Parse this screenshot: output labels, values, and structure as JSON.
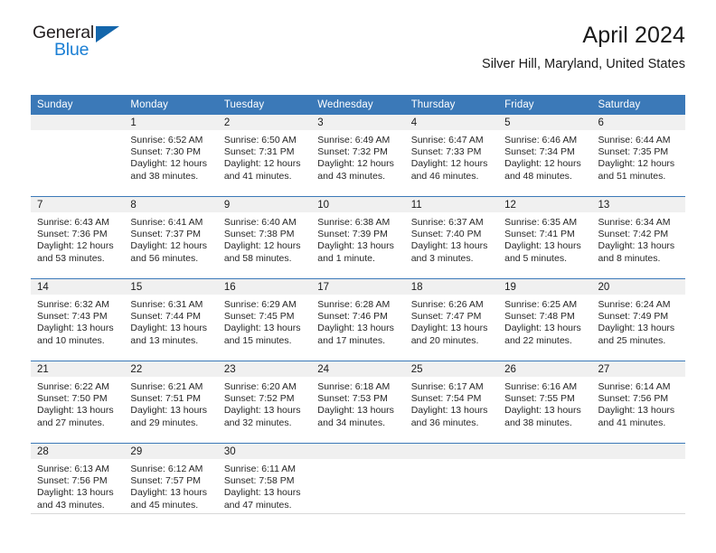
{
  "brand": {
    "name_part1": "General",
    "name_part2": "Blue",
    "logo_icon": "blue-triangle",
    "color_dark": "#231f20",
    "color_blue": "#1b7fd4",
    "triangle_color": "#1466ab"
  },
  "header": {
    "title": "April 2024",
    "subtitle": "Silver Hill, Maryland, United States",
    "accent_color": "#3b79b8",
    "daynum_band_color": "#f0f0f0"
  },
  "weekdays": [
    "Sunday",
    "Monday",
    "Tuesday",
    "Wednesday",
    "Thursday",
    "Friday",
    "Saturday"
  ],
  "weeks": [
    [
      {
        "day": "",
        "sunrise": "",
        "sunset": "",
        "daylight_l1": "",
        "daylight_l2": ""
      },
      {
        "day": "1",
        "sunrise": "Sunrise: 6:52 AM",
        "sunset": "Sunset: 7:30 PM",
        "daylight_l1": "Daylight: 12 hours",
        "daylight_l2": "and 38 minutes."
      },
      {
        "day": "2",
        "sunrise": "Sunrise: 6:50 AM",
        "sunset": "Sunset: 7:31 PM",
        "daylight_l1": "Daylight: 12 hours",
        "daylight_l2": "and 41 minutes."
      },
      {
        "day": "3",
        "sunrise": "Sunrise: 6:49 AM",
        "sunset": "Sunset: 7:32 PM",
        "daylight_l1": "Daylight: 12 hours",
        "daylight_l2": "and 43 minutes."
      },
      {
        "day": "4",
        "sunrise": "Sunrise: 6:47 AM",
        "sunset": "Sunset: 7:33 PM",
        "daylight_l1": "Daylight: 12 hours",
        "daylight_l2": "and 46 minutes."
      },
      {
        "day": "5",
        "sunrise": "Sunrise: 6:46 AM",
        "sunset": "Sunset: 7:34 PM",
        "daylight_l1": "Daylight: 12 hours",
        "daylight_l2": "and 48 minutes."
      },
      {
        "day": "6",
        "sunrise": "Sunrise: 6:44 AM",
        "sunset": "Sunset: 7:35 PM",
        "daylight_l1": "Daylight: 12 hours",
        "daylight_l2": "and 51 minutes."
      }
    ],
    [
      {
        "day": "7",
        "sunrise": "Sunrise: 6:43 AM",
        "sunset": "Sunset: 7:36 PM",
        "daylight_l1": "Daylight: 12 hours",
        "daylight_l2": "and 53 minutes."
      },
      {
        "day": "8",
        "sunrise": "Sunrise: 6:41 AM",
        "sunset": "Sunset: 7:37 PM",
        "daylight_l1": "Daylight: 12 hours",
        "daylight_l2": "and 56 minutes."
      },
      {
        "day": "9",
        "sunrise": "Sunrise: 6:40 AM",
        "sunset": "Sunset: 7:38 PM",
        "daylight_l1": "Daylight: 12 hours",
        "daylight_l2": "and 58 minutes."
      },
      {
        "day": "10",
        "sunrise": "Sunrise: 6:38 AM",
        "sunset": "Sunset: 7:39 PM",
        "daylight_l1": "Daylight: 13 hours",
        "daylight_l2": "and 1 minute."
      },
      {
        "day": "11",
        "sunrise": "Sunrise: 6:37 AM",
        "sunset": "Sunset: 7:40 PM",
        "daylight_l1": "Daylight: 13 hours",
        "daylight_l2": "and 3 minutes."
      },
      {
        "day": "12",
        "sunrise": "Sunrise: 6:35 AM",
        "sunset": "Sunset: 7:41 PM",
        "daylight_l1": "Daylight: 13 hours",
        "daylight_l2": "and 5 minutes."
      },
      {
        "day": "13",
        "sunrise": "Sunrise: 6:34 AM",
        "sunset": "Sunset: 7:42 PM",
        "daylight_l1": "Daylight: 13 hours",
        "daylight_l2": "and 8 minutes."
      }
    ],
    [
      {
        "day": "14",
        "sunrise": "Sunrise: 6:32 AM",
        "sunset": "Sunset: 7:43 PM",
        "daylight_l1": "Daylight: 13 hours",
        "daylight_l2": "and 10 minutes."
      },
      {
        "day": "15",
        "sunrise": "Sunrise: 6:31 AM",
        "sunset": "Sunset: 7:44 PM",
        "daylight_l1": "Daylight: 13 hours",
        "daylight_l2": "and 13 minutes."
      },
      {
        "day": "16",
        "sunrise": "Sunrise: 6:29 AM",
        "sunset": "Sunset: 7:45 PM",
        "daylight_l1": "Daylight: 13 hours",
        "daylight_l2": "and 15 minutes."
      },
      {
        "day": "17",
        "sunrise": "Sunrise: 6:28 AM",
        "sunset": "Sunset: 7:46 PM",
        "daylight_l1": "Daylight: 13 hours",
        "daylight_l2": "and 17 minutes."
      },
      {
        "day": "18",
        "sunrise": "Sunrise: 6:26 AM",
        "sunset": "Sunset: 7:47 PM",
        "daylight_l1": "Daylight: 13 hours",
        "daylight_l2": "and 20 minutes."
      },
      {
        "day": "19",
        "sunrise": "Sunrise: 6:25 AM",
        "sunset": "Sunset: 7:48 PM",
        "daylight_l1": "Daylight: 13 hours",
        "daylight_l2": "and 22 minutes."
      },
      {
        "day": "20",
        "sunrise": "Sunrise: 6:24 AM",
        "sunset": "Sunset: 7:49 PM",
        "daylight_l1": "Daylight: 13 hours",
        "daylight_l2": "and 25 minutes."
      }
    ],
    [
      {
        "day": "21",
        "sunrise": "Sunrise: 6:22 AM",
        "sunset": "Sunset: 7:50 PM",
        "daylight_l1": "Daylight: 13 hours",
        "daylight_l2": "and 27 minutes."
      },
      {
        "day": "22",
        "sunrise": "Sunrise: 6:21 AM",
        "sunset": "Sunset: 7:51 PM",
        "daylight_l1": "Daylight: 13 hours",
        "daylight_l2": "and 29 minutes."
      },
      {
        "day": "23",
        "sunrise": "Sunrise: 6:20 AM",
        "sunset": "Sunset: 7:52 PM",
        "daylight_l1": "Daylight: 13 hours",
        "daylight_l2": "and 32 minutes."
      },
      {
        "day": "24",
        "sunrise": "Sunrise: 6:18 AM",
        "sunset": "Sunset: 7:53 PM",
        "daylight_l1": "Daylight: 13 hours",
        "daylight_l2": "and 34 minutes."
      },
      {
        "day": "25",
        "sunrise": "Sunrise: 6:17 AM",
        "sunset": "Sunset: 7:54 PM",
        "daylight_l1": "Daylight: 13 hours",
        "daylight_l2": "and 36 minutes."
      },
      {
        "day": "26",
        "sunrise": "Sunrise: 6:16 AM",
        "sunset": "Sunset: 7:55 PM",
        "daylight_l1": "Daylight: 13 hours",
        "daylight_l2": "and 38 minutes."
      },
      {
        "day": "27",
        "sunrise": "Sunrise: 6:14 AM",
        "sunset": "Sunset: 7:56 PM",
        "daylight_l1": "Daylight: 13 hours",
        "daylight_l2": "and 41 minutes."
      }
    ],
    [
      {
        "day": "28",
        "sunrise": "Sunrise: 6:13 AM",
        "sunset": "Sunset: 7:56 PM",
        "daylight_l1": "Daylight: 13 hours",
        "daylight_l2": "and 43 minutes."
      },
      {
        "day": "29",
        "sunrise": "Sunrise: 6:12 AM",
        "sunset": "Sunset: 7:57 PM",
        "daylight_l1": "Daylight: 13 hours",
        "daylight_l2": "and 45 minutes."
      },
      {
        "day": "30",
        "sunrise": "Sunrise: 6:11 AM",
        "sunset": "Sunset: 7:58 PM",
        "daylight_l1": "Daylight: 13 hours",
        "daylight_l2": "and 47 minutes."
      },
      {
        "day": "",
        "sunrise": "",
        "sunset": "",
        "daylight_l1": "",
        "daylight_l2": ""
      },
      {
        "day": "",
        "sunrise": "",
        "sunset": "",
        "daylight_l1": "",
        "daylight_l2": ""
      },
      {
        "day": "",
        "sunrise": "",
        "sunset": "",
        "daylight_l1": "",
        "daylight_l2": ""
      },
      {
        "day": "",
        "sunrise": "",
        "sunset": "",
        "daylight_l1": "",
        "daylight_l2": ""
      }
    ]
  ]
}
